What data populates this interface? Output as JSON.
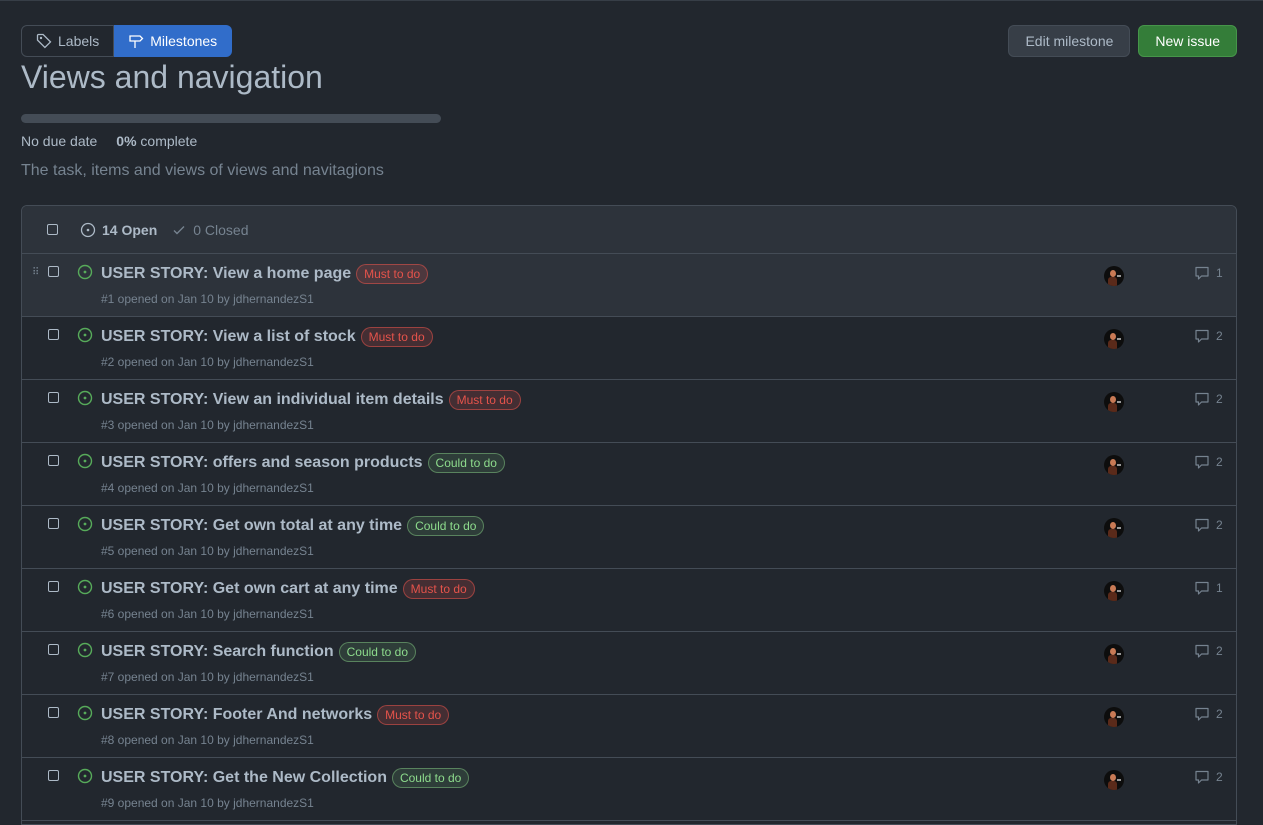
{
  "nav": {
    "labels": "Labels",
    "milestones": "Milestones"
  },
  "actions": {
    "edit": "Edit milestone",
    "new_issue": "New issue"
  },
  "milestone": {
    "title": "Views and navigation",
    "due": "No due date",
    "percent": "0%",
    "complete_word": "complete",
    "progress_fraction": 0,
    "description": "The task, items and views of views and navitagions"
  },
  "header": {
    "open": "14 Open",
    "closed": "0 Closed"
  },
  "colors": {
    "must": "#e5534b",
    "could": "#8ddb8c",
    "open_icon": "#57ab5a"
  },
  "issues": [
    {
      "title": "USER STORY: View a home page",
      "label": "Must to do",
      "kind": "must",
      "sub": "#1 opened on Jan 10 by jdhernandezS1",
      "comments": "1"
    },
    {
      "title": "USER STORY: View a list of stock",
      "label": "Must to do",
      "kind": "must",
      "sub": "#2 opened on Jan 10 by jdhernandezS1",
      "comments": "2"
    },
    {
      "title": "USER STORY: View an individual item details",
      "label": "Must to do",
      "kind": "must",
      "sub": "#3 opened on Jan 10 by jdhernandezS1",
      "comments": "2"
    },
    {
      "title": "USER STORY: offers and season products",
      "label": "Could to do",
      "kind": "could",
      "sub": "#4 opened on Jan 10 by jdhernandezS1",
      "comments": "2"
    },
    {
      "title": "USER STORY: Get own total at any time",
      "label": "Could to do",
      "kind": "could",
      "sub": "#5 opened on Jan 10 by jdhernandezS1",
      "comments": "2"
    },
    {
      "title": "USER STORY: Get own cart at any time",
      "label": "Must to do",
      "kind": "must",
      "sub": "#6 opened on Jan 10 by jdhernandezS1",
      "comments": "1"
    },
    {
      "title": "USER STORY: Search function",
      "label": "Could to do",
      "kind": "could",
      "sub": "#7 opened on Jan 10 by jdhernandezS1",
      "comments": "2"
    },
    {
      "title": "USER STORY: Footer And networks",
      "label": "Must to do",
      "kind": "must",
      "sub": "#8 opened on Jan 10 by jdhernandezS1",
      "comments": "2"
    },
    {
      "title": "USER STORY: Get the New Collection",
      "label": "Could to do",
      "kind": "could",
      "sub": "#9 opened on Jan 10 by jdhernandezS1",
      "comments": "2"
    }
  ]
}
